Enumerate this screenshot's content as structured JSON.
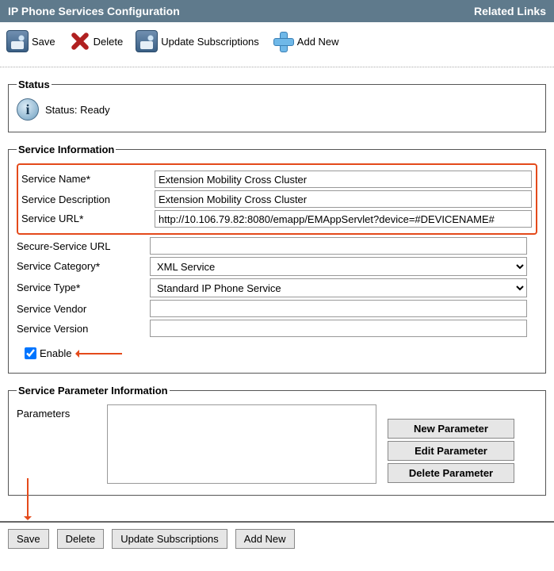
{
  "header": {
    "title": "IP Phone Services Configuration",
    "related": "Related Links"
  },
  "toolbar": {
    "save": "Save",
    "delete": "Delete",
    "update": "Update Subscriptions",
    "add": "Add New"
  },
  "status": {
    "legend": "Status",
    "text": "Status: Ready"
  },
  "serviceInfo": {
    "legend": "Service Information",
    "labels": {
      "name": "Service Name",
      "desc": "Service Description",
      "url": "Service URL",
      "secure": "Secure-Service URL",
      "category": "Service Category",
      "type": "Service Type",
      "vendor": "Service Vendor",
      "version": "Service Version",
      "enable": "Enable"
    },
    "values": {
      "name": "Extension Mobility Cross Cluster",
      "desc": "Extension Mobility Cross Cluster",
      "url": "http://10.106.79.82:8080/emapp/EMAppServlet?device=#DEVICENAME#",
      "secure": "",
      "category": "XML Service",
      "type": "Standard IP Phone Service",
      "vendor": "",
      "version": ""
    }
  },
  "paramInfo": {
    "legend": "Service Parameter Information",
    "label": "Parameters",
    "buttons": {
      "new": "New Parameter",
      "edit": "Edit Parameter",
      "del": "Delete Parameter"
    }
  },
  "bottom": {
    "save": "Save",
    "delete": "Delete",
    "update": "Update Subscriptions",
    "add": "Add New"
  }
}
